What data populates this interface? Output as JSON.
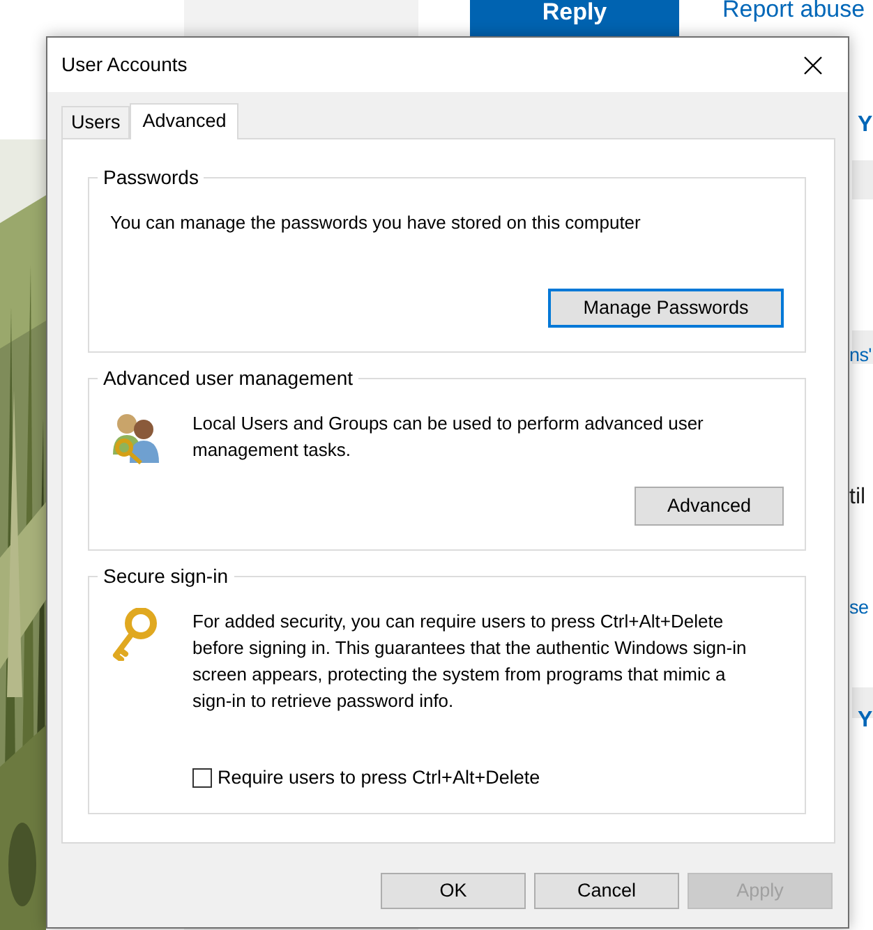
{
  "background": {
    "reply_button": "Reply",
    "report_link": "Report abuse",
    "fragments": [
      {
        "text": "Y",
        "kind": "heading"
      },
      {
        "text": "ns'",
        "kind": "link"
      },
      {
        "text": "til",
        "kind": "plain"
      },
      {
        "text": "se",
        "kind": "link"
      },
      {
        "text": "Y",
        "kind": "heading"
      }
    ]
  },
  "dialog": {
    "title": "User Accounts",
    "tabs": [
      {
        "label": "Users",
        "selected": false
      },
      {
        "label": "Advanced",
        "selected": true
      }
    ],
    "groups": [
      {
        "kind": "action",
        "title": "Passwords",
        "text": "You can manage the passwords you have stored on this computer",
        "button": {
          "label": "Manage Passwords",
          "focused": true
        }
      },
      {
        "kind": "tool",
        "title": "Advanced user management",
        "text": "Local Users and Groups can be used to perform advanced user management tasks.",
        "button": {
          "label": "Advanced",
          "focused": false
        }
      },
      {
        "kind": "option",
        "title": "Secure sign-in",
        "text": "For added security, you can require users to press Ctrl+Alt+Delete before signing in. This guarantees that the authentic Windows sign-in screen appears, protecting the system from programs that mimic a sign-in to retrieve password info.",
        "checkbox": {
          "label": "Require users to press Ctrl+Alt+Delete",
          "checked": false
        }
      }
    ],
    "buttons": [
      {
        "label": "OK",
        "disabled": false
      },
      {
        "label": "Cancel",
        "disabled": false
      },
      {
        "label": "Apply",
        "disabled": true
      }
    ]
  }
}
